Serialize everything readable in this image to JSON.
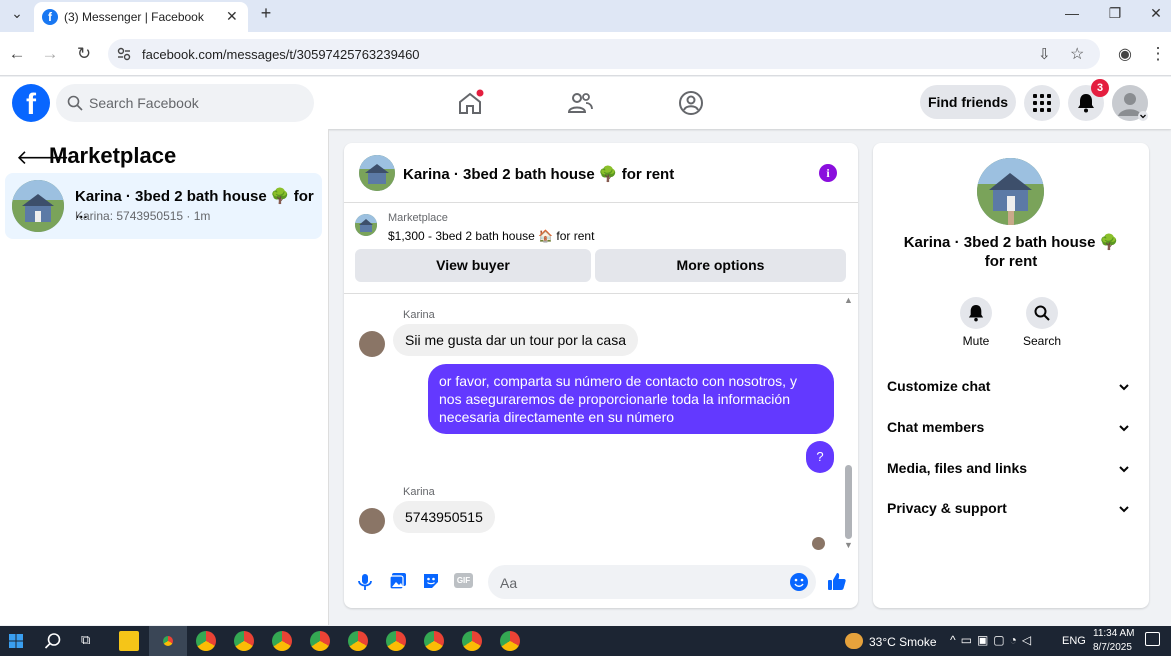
{
  "browser": {
    "tab_title": "(3) Messenger | Facebook",
    "url": "facebook.com/messages/t/30597425763239460"
  },
  "header": {
    "search_placeholder": "Search Facebook",
    "find_friends": "Find friends",
    "notification_count": "3"
  },
  "left": {
    "title": "Marketplace",
    "conversation": {
      "name": "Karina · 3bed 2 bath house 🌳 for ...",
      "preview": "Karina: 5743950515 · 1m"
    }
  },
  "chat": {
    "title": "Karina · 3bed 2 bath house 🌳 for rent",
    "marketplace_label": "Marketplace",
    "listing": "$1,300 - 3bed 2 bath house 🏠 for rent",
    "view_buyer": "View buyer",
    "more_options": "More options",
    "messages": [
      {
        "sender": "Karina",
        "text": "Sii me gusta dar un tour por la casa"
      },
      {
        "sender": "me",
        "text": "or favor, comparta su número de contacto con nosotros, y nos aseguraremos de proporcionarle toda la información necesaria directamente en su número"
      },
      {
        "sender": "me",
        "text": "?"
      },
      {
        "sender": "Karina",
        "text": "5743950515"
      }
    ],
    "composer_placeholder": "Aa"
  },
  "right": {
    "name": "Karina · 3bed 2 bath house 🌳 for rent",
    "mute": "Mute",
    "search": "Search",
    "sections": [
      "Customize chat",
      "Chat members",
      "Media, files and links",
      "Privacy & support"
    ]
  },
  "taskbar": {
    "weather": "33°C  Smoke",
    "lang": "ENG",
    "time": "11:34 AM",
    "date": "8/7/2025"
  },
  "colors": {
    "fb_blue": "#0866ff",
    "bubble_out": "#6339ff",
    "info": "#8a0edd",
    "badge": "#e41e3f"
  }
}
